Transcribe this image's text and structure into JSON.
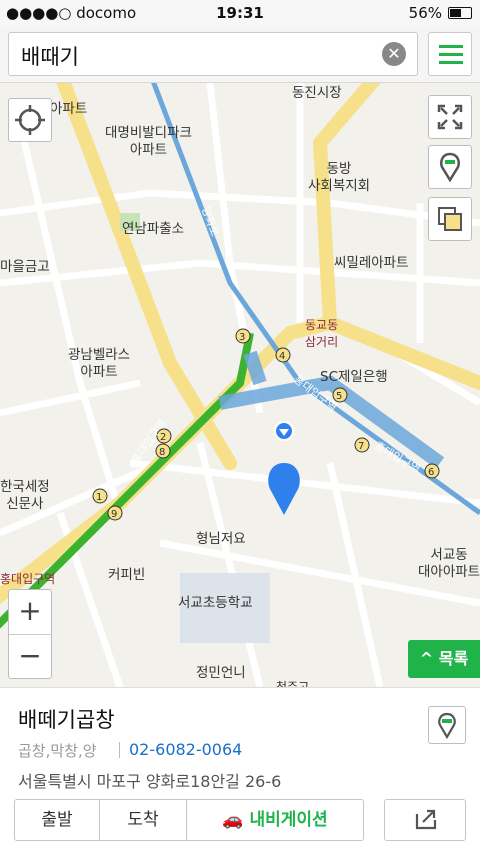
{
  "status_bar": {
    "carrier": "●●●●○ docomo",
    "time": "19:31",
    "battery": "56%"
  },
  "search": {
    "query": "배때기"
  },
  "map_labels": {
    "l1": "아파트",
    "l2": "대명비발디파크\n아파트",
    "l3": "동진시장",
    "l4": "동방\n사회복지회",
    "l5": "연남파출소",
    "l6": "씨밀레아파트",
    "l7": "마을금고",
    "l8": "광남벨라스\n아파트",
    "l9": "동교동\n삼거리",
    "l10": "SC제일은행",
    "l11": "홍대입구역",
    "l12": "홍대입구역",
    "l13": "홍대입구역",
    "l14": "한국세정\n신문사",
    "l15": "형님저요",
    "l16": "커피빈",
    "l17": "서교초등학교",
    "l18": "서교동\n대아아파트",
    "l19": "정민언니",
    "l20": "홍대입구역",
    "road1": "양화로",
    "road2": "청주고"
  },
  "station_numbers": [
    "1",
    "2",
    "3",
    "4",
    "5",
    "6",
    "7",
    "8",
    "9"
  ],
  "controls": {
    "zoom_in": "+",
    "zoom_out": "−",
    "list_label": "^ 목록"
  },
  "place": {
    "name": "배떼기곱창",
    "category": "곱창,막창,양",
    "phone": "02-6082-0064",
    "address": "서울특별시 마포구 양화로18안길 26-6"
  },
  "actions": {
    "start": "출발",
    "arrive": "도착",
    "navigation": "내비게이션"
  },
  "colors": {
    "accent": "#1fb34a",
    "line2": "#3cb32e",
    "airport_line": "#6ba7da",
    "road": "#f6e08a"
  }
}
